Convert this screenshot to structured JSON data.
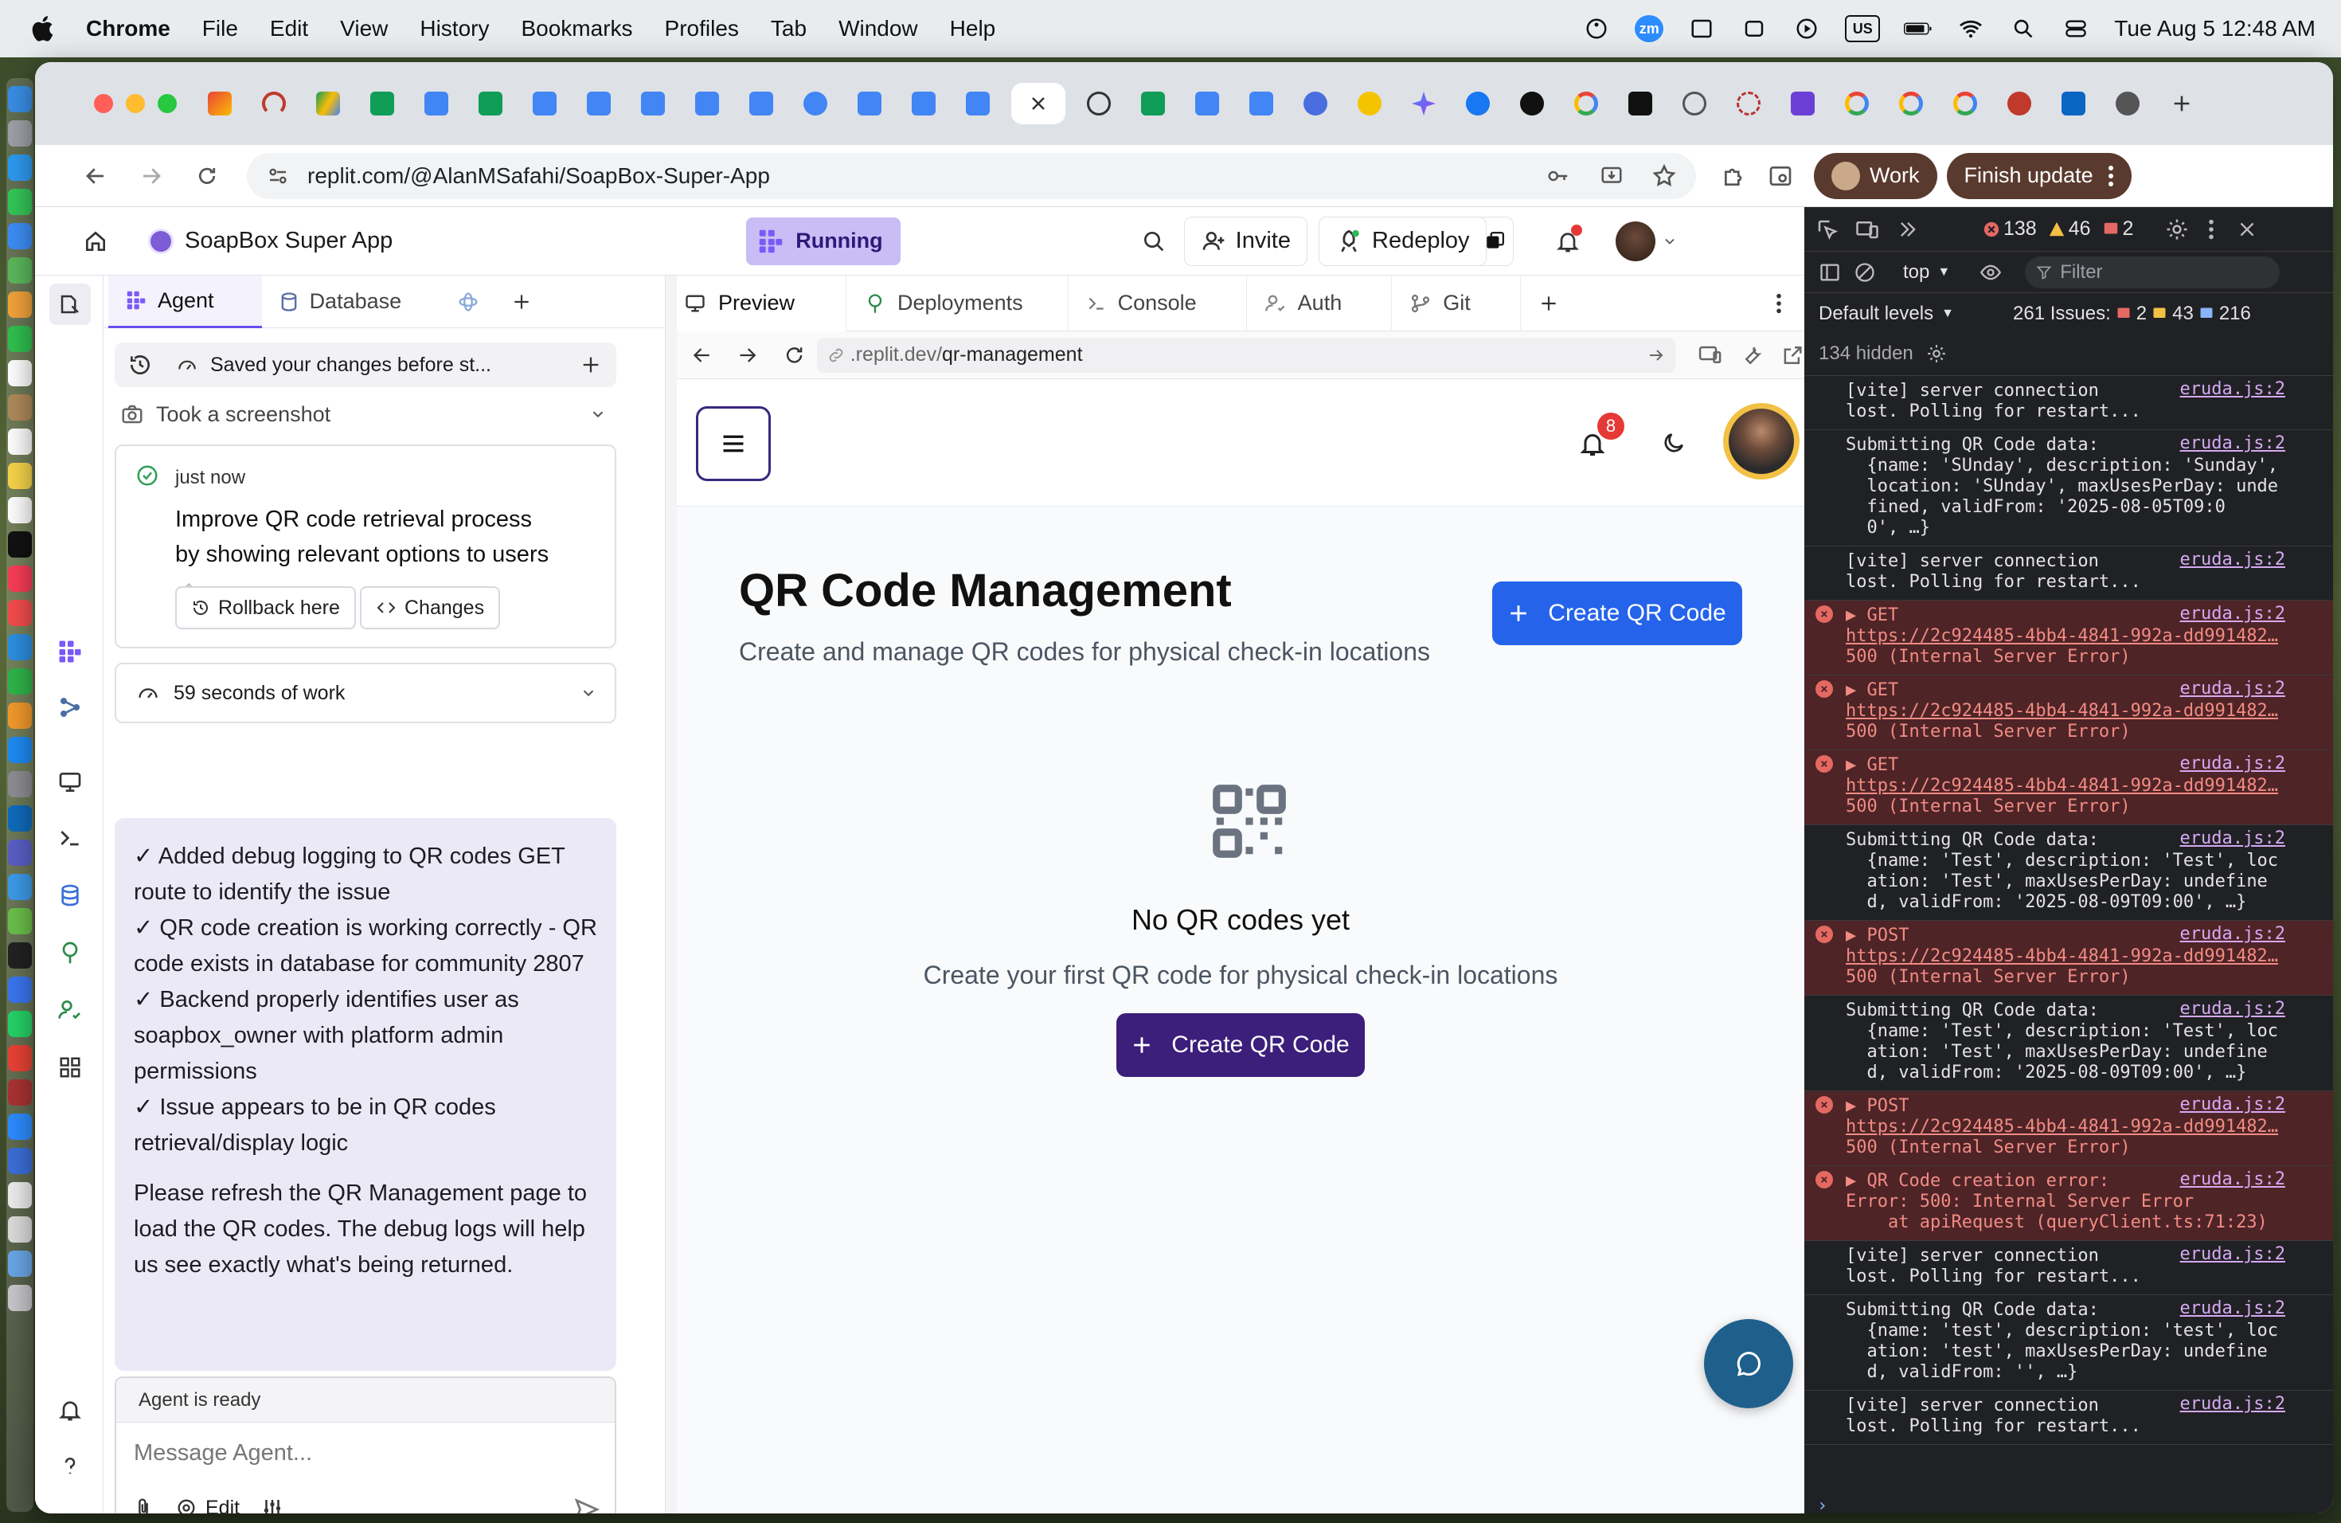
{
  "menubar": {
    "app": "Chrome",
    "items": [
      "File",
      "Edit",
      "View",
      "History",
      "Bookmarks",
      "Profiles",
      "Tab",
      "Window",
      "Help"
    ],
    "tray": {
      "zoom": "zm",
      "keyboard": "US"
    },
    "clock": "Tue Aug 5  12:48 AM"
  },
  "browser": {
    "url": "replit.com/@AlanMSafahi/SoapBox-Super-App",
    "profile": "Work",
    "finish_update": "Finish update"
  },
  "replit": {
    "app_name": "SoapBox Super App",
    "status": "Running",
    "invite": "Invite",
    "redeploy": "Redeploy",
    "agent_tabs": [
      "Agent",
      "Database"
    ],
    "checkpoint_text": "Saved your changes before st...",
    "took_screenshot": "Took a screenshot",
    "checkpoint_time": "just now",
    "checkpoint_title": "Improve QR code retrieval process by showing relevant options to users",
    "rollback_label": "Rollback here",
    "changes_label": "Changes",
    "work_time": "59 seconds of work",
    "message_lines": [
      "✓ Added debug logging to QR codes GET route to identify the issue",
      "✓ QR code creation is working correctly - QR code exists in database for community 2807",
      "✓ Backend properly identifies user as soapbox_owner with platform admin permissions",
      "✓ Issue appears to be in QR codes retrieval/display logic"
    ],
    "message_footer": "Please refresh the QR Management page to load the QR codes. The debug logs will help us see exactly what's being returned.",
    "agent_status": "Agent is ready",
    "message_placeholder": "Message Agent...",
    "edit_label": "Edit",
    "work_tabs": [
      "Preview",
      "Deployments",
      "Console",
      "Auth",
      "Git"
    ],
    "preview_url_prefix": ".replit.dev/",
    "preview_url_path": "qr-management"
  },
  "app": {
    "notification_count": "8",
    "page_title": "QR Code Management",
    "page_subtitle": "Create and manage QR codes for physical check-in locations",
    "create_button": "Create QR Code",
    "empty_title": "No QR codes yet",
    "empty_subtitle": "Create your first QR code for physical check-in locations",
    "empty_button": "Create QR Code"
  },
  "devtools": {
    "errors": "138",
    "warnings": "46",
    "info": "2",
    "context": "top",
    "filter_placeholder": "Filter",
    "levels": "Default levels",
    "issues_label": "261 Issues:",
    "issues_err": "2",
    "issues_warn": "43",
    "issues_info": "216",
    "hidden": "134 hidden",
    "source": "eruda.js:2",
    "logs": [
      {
        "type": "log",
        "lines": [
          "[vite] server connection",
          "lost. Polling for restart..."
        ]
      },
      {
        "type": "log",
        "lines": [
          "Submitting QR Code data:",
          "  {name: 'SUnday', description: 'Sunday',",
          "  location: 'SUnday', maxUsesPerDay: unde",
          "  fined, validFrom: '2025-08-05T09:0",
          "  0', …}"
        ]
      },
      {
        "type": "log",
        "lines": [
          "[vite] server connection",
          "lost. Polling for restart..."
        ]
      },
      {
        "type": "err",
        "lines": [
          "▶ GET",
          "https://2c924485-4bb4-4841-992a-dd991482…",
          "500 (Internal Server Error)"
        ]
      },
      {
        "type": "err",
        "lines": [
          "▶ GET",
          "https://2c924485-4bb4-4841-992a-dd991482…",
          "500 (Internal Server Error)"
        ]
      },
      {
        "type": "err",
        "lines": [
          "▶ GET",
          "https://2c924485-4bb4-4841-992a-dd991482…",
          "500 (Internal Server Error)"
        ]
      },
      {
        "type": "log",
        "lines": [
          "Submitting QR Code data:",
          "  {name: 'Test', description: 'Test', loc",
          "  ation: 'Test', maxUsesPerDay: undefine",
          "  d, validFrom: '2025-08-09T09:00', …}"
        ]
      },
      {
        "type": "err",
        "lines": [
          "▶ POST",
          "https://2c924485-4bb4-4841-992a-dd991482…",
          "500 (Internal Server Error)"
        ]
      },
      {
        "type": "log",
        "lines": [
          "Submitting QR Code data:",
          "  {name: 'Test', description: 'Test', loc",
          "  ation: 'Test', maxUsesPerDay: undefine",
          "  d, validFrom: '2025-08-09T09:00', …}"
        ]
      },
      {
        "type": "err",
        "lines": [
          "▶ POST",
          "https://2c924485-4bb4-4841-992a-dd991482…",
          "500 (Internal Server Error)"
        ]
      },
      {
        "type": "err",
        "lines": [
          "▶ QR Code creation error:",
          "Error: 500: Internal Server Error",
          "    at apiRequest (queryClient.ts:71:23)"
        ]
      },
      {
        "type": "log",
        "lines": [
          "[vite] server connection",
          "lost. Polling for restart..."
        ]
      },
      {
        "type": "log",
        "lines": [
          "Submitting QR Code data:",
          "  {name: 'test', description: 'test', loc",
          "  ation: 'test', maxUsesPerDay: undefine",
          "  d, validFrom: '', …}"
        ]
      },
      {
        "type": "log",
        "lines": [
          "[vite] server connection",
          "lost. Polling for restart..."
        ]
      }
    ]
  }
}
